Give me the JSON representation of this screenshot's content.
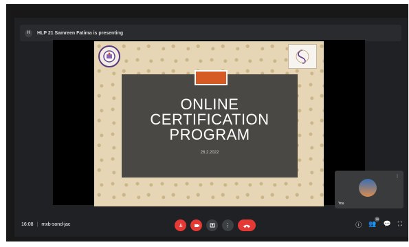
{
  "meeting": {
    "presenter_initial": "H",
    "presenter_banner": "HLP 21 Samreen Fatima is presenting",
    "time": "16:08",
    "separator": "|",
    "meeting_code": "mxb-sond-jac",
    "participant_count": "20"
  },
  "slide": {
    "title_line_1": "ONLINE",
    "title_line_2": "CERTIFICATION",
    "title_line_3": "PROGRAM",
    "date": "26.2.2022"
  },
  "self_view": {
    "name": "You"
  },
  "colors": {
    "end_call": "#e53935",
    "slide_accent": "#d65a23"
  },
  "icons": {
    "controls": [
      "mic-off-icon",
      "camera-off-icon",
      "present-icon",
      "more-icon",
      "end-call-icon"
    ],
    "right": [
      "info-icon",
      "people-icon",
      "chat-icon",
      "activities-icon"
    ]
  }
}
